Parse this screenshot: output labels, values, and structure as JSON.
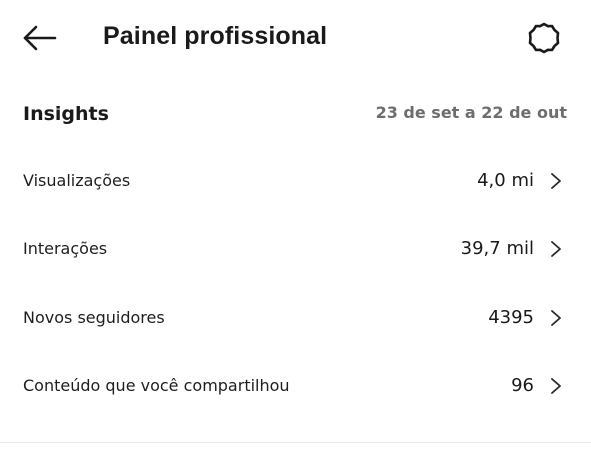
{
  "header": {
    "back_icon": "arrow-left-icon",
    "title": "Painel profissional",
    "settings_icon": "gear-icon"
  },
  "insights": {
    "title": "Insights",
    "date_range": "23 de set a 22 de out",
    "rows": [
      {
        "label": "Visualizações",
        "value": "4,0 mi"
      },
      {
        "label": "Interações",
        "value": "39,7 mil"
      },
      {
        "label": "Novos seguidores",
        "value": "4395"
      },
      {
        "label": "Conteúdo que você compartilhou",
        "value": "96"
      }
    ],
    "chevron_icon": "chevron-right-icon"
  },
  "colors": {
    "text": "#1a1a1a",
    "muted": "#6e6e6e",
    "divider": "#e6e6e6",
    "background": "#ffffff"
  }
}
